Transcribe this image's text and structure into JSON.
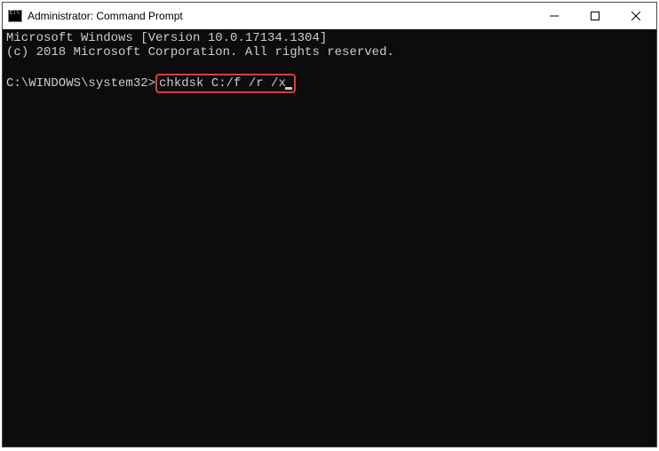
{
  "titlebar": {
    "title": "Administrator: Command Prompt"
  },
  "terminal": {
    "line1": "Microsoft Windows [Version 10.0.17134.1304]",
    "line2": "(c) 2018 Microsoft Corporation. All rights reserved.",
    "prompt": "C:\\WINDOWS\\system32>",
    "command": "chkdsk C:/f /r /x"
  }
}
